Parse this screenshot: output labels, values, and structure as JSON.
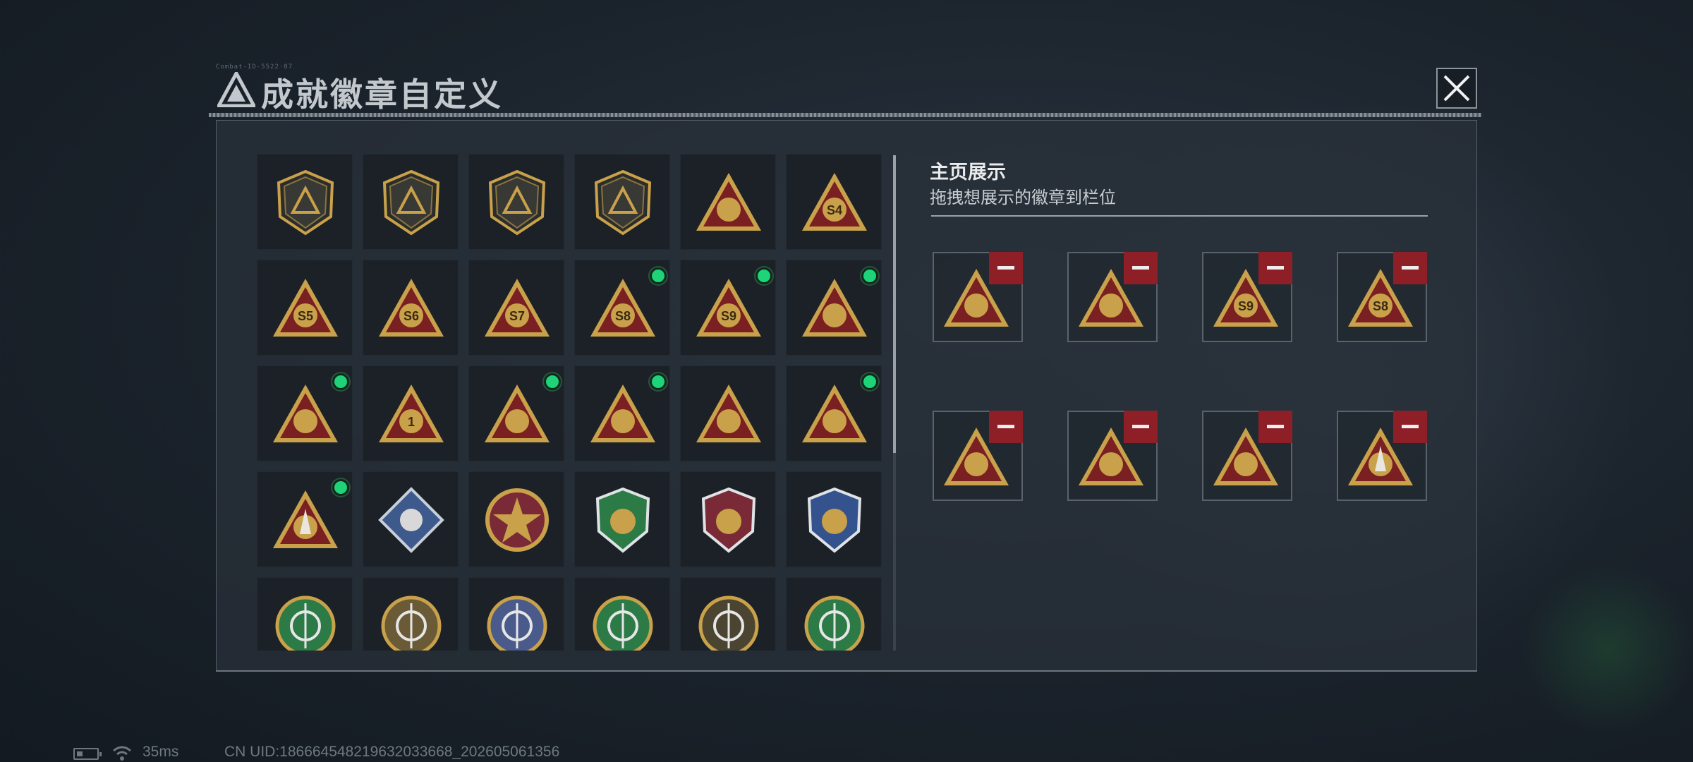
{
  "header": {
    "title": "成就徽章自定义",
    "tiny_code": "Combat-ID-5522·07"
  },
  "home_display": {
    "title": "主页展示",
    "subtitle": "拖拽想展示的徽章到栏位"
  },
  "badges": [
    {
      "icon": "triangle-shield-badge",
      "new": false
    },
    {
      "icon": "helicopter-shield-badge",
      "new": false
    },
    {
      "icon": "diamond-shield-badge",
      "new": false
    },
    {
      "icon": "dagger-shield-badge",
      "new": false
    },
    {
      "icon": "dish-triangle-badge",
      "new": false
    },
    {
      "icon": "s4-triangle-badge",
      "label": "S4",
      "new": false
    },
    {
      "icon": "s5-triangle-badge",
      "label": "S5",
      "new": false
    },
    {
      "icon": "s6-triangle-badge",
      "label": "S6",
      "new": false
    },
    {
      "icon": "s7-triangle-badge",
      "label": "S7",
      "new": false
    },
    {
      "icon": "s8-triangle-badge",
      "label": "S8",
      "new": true
    },
    {
      "icon": "s9-triangle-badge",
      "label": "S9",
      "new": true
    },
    {
      "icon": "medal-triangle-badge",
      "new": true
    },
    {
      "icon": "nest-triangle-badge",
      "new": true
    },
    {
      "icon": "number-one-triangle-badge",
      "label": "1",
      "new": false
    },
    {
      "icon": "block-triangle-badge",
      "new": true
    },
    {
      "icon": "lantern-triangle-badge",
      "new": true
    },
    {
      "icon": "kneeling-soldier-triangle-badge",
      "new": false
    },
    {
      "icon": "soldiers-triangle-badge",
      "new": true
    },
    {
      "icon": "rocket-triangle-badge",
      "new": true
    },
    {
      "icon": "rose-diamond-badge",
      "new": false
    },
    {
      "icon": "star-medallion-badge",
      "new": false
    },
    {
      "icon": "green-crest-badge",
      "new": false
    },
    {
      "icon": "gold-star-crest-badge",
      "new": false
    },
    {
      "icon": "blue-gem-crest-badge",
      "new": false
    },
    {
      "icon": "skull-scope-badge",
      "new": false
    },
    {
      "icon": "bear-head-badge",
      "new": false
    },
    {
      "icon": "sniper-gold-badge",
      "new": false
    },
    {
      "icon": "rifle-green-badge",
      "new": false
    },
    {
      "icon": "knife-bronze-badge",
      "new": false
    },
    {
      "icon": "smg-green-badge",
      "new": false
    }
  ],
  "slots": [
    {
      "icon": "block-triangle-badge"
    },
    {
      "icon": "lantern-triangle-badge"
    },
    {
      "icon": "s9-triangle-badge",
      "label": "S9"
    },
    {
      "icon": "s8-triangle-badge",
      "label": "S8"
    },
    {
      "icon": "medal-triangle-badge"
    },
    {
      "icon": "soldiers-triangle-badge"
    },
    {
      "icon": "nest-triangle-badge"
    },
    {
      "icon": "rocket-triangle-badge"
    }
  ],
  "status": {
    "ping": "35ms",
    "uid": "CN UID:186664548219632033668_202605061356"
  },
  "colors": {
    "gold": "#c9a14a",
    "red": "#7a1f22",
    "green_dot": "#1ed378",
    "remove_red": "#8e1f26",
    "panel": "#28303a"
  }
}
